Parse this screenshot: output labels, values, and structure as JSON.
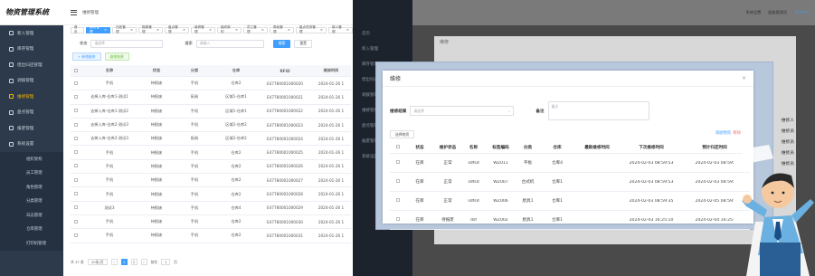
{
  "app": {
    "logo": "物资管理系统",
    "breadcrumb": "维修管理",
    "tabs": [
      "首页",
      "维修管理",
      "归还管理",
      "报废管理",
      "盘点管理",
      "维修管理",
      "组织架构",
      "员工管理",
      "角色管理",
      "盘点任务管理",
      "新入管理"
    ],
    "sidebar": [
      {
        "label": "新入管理",
        "active": false
      },
      {
        "label": "库存管理",
        "active": false
      },
      {
        "label": "借出归还管理",
        "active": false
      },
      {
        "label": "调拨管理",
        "active": false
      },
      {
        "label": "维修管理",
        "active": true
      },
      {
        "label": "盘点管理",
        "active": false
      },
      {
        "label": "报废管理",
        "active": false
      },
      {
        "label": "系统设置",
        "active": false
      }
    ],
    "sub_menu": [
      "组织架构",
      "员工管理",
      "角色管理",
      "分类管理",
      "日志管理",
      "仓库管理",
      "打印机管理"
    ],
    "filter": {
      "status_label": "状态",
      "status_placeholder": "请选择",
      "search_label": "搜索",
      "search_placeholder": "请输入",
      "search_btn": "搜索",
      "reset_btn": "重置"
    },
    "actions": {
      "add": "+ 新增维修",
      "repair": "维修结果"
    },
    "columns": [
      "名称",
      "状态",
      "分类",
      "仓库",
      "RFID",
      "维修时间"
    ],
    "rows": [
      [
        "手机",
        "待报废",
        "手机",
        "仓库2",
        "E47780001000020",
        "2024-01-26 1"
      ],
      [
        "去掉入库-仓库1-测试1",
        "待报废",
        "厨具",
        "区域1-仓库1",
        "E47780001000021",
        "2024-01-26 1"
      ],
      [
        "去掉入库-仓库1-测试2",
        "待报废",
        "手机",
        "区域1-仓库1",
        "E47780001000022",
        "2024-01-26 1"
      ],
      [
        "去掉入库-仓库2-测试3",
        "待报废",
        "手机",
        "区域2-仓库2",
        "E47780001000023",
        "2024-01-26 1"
      ],
      [
        "去掉入库-仓库2-测试3",
        "待报废",
        "厨具",
        "区域2-仓库2",
        "E47780001000024",
        "2024-01-26 1"
      ],
      [
        "手机",
        "待报废",
        "手机",
        "仓库2",
        "E47780001000025",
        "2024-01-26 1"
      ],
      [
        "手机",
        "待报废",
        "手机",
        "仓库2",
        "E47780001000026",
        "2024-01-26 1"
      ],
      [
        "手机",
        "待报废",
        "手机",
        "仓库2",
        "E47780001000027",
        "2024-01-26 1"
      ],
      [
        "手机",
        "待报废",
        "手机",
        "仓库2",
        "E47780001000028",
        "2024-01-26 1"
      ],
      [
        "测试3",
        "待报废",
        "手机",
        "仓库4",
        "E47780001000029",
        "2024-01-26 1"
      ],
      [
        "手机",
        "待报废",
        "手机",
        "仓库2",
        "E47780001000030",
        "2024-01-26 1"
      ],
      [
        "手机",
        "待报废",
        "手机",
        "仓库2",
        "E47780001000031",
        "2024-01-26 1"
      ]
    ],
    "pager": {
      "total": "共 37 条",
      "size": "20条/页",
      "pages": [
        "1",
        "2"
      ],
      "current": "1",
      "goto": "前往",
      "goto_val": "1",
      "unit": "页"
    }
  },
  "right": {
    "top_right": [
      "系统设置",
      "超级管理员",
      "个人中心"
    ],
    "bg_dialog_title": "维修",
    "dim_menu": [
      "首页",
      "新入管理",
      "库存管理",
      "借出归还管理",
      "调拨管理",
      "维修管理",
      "盘点管理",
      "报废管理",
      "系统设置"
    ],
    "bg_side_text": [
      "维修人",
      "维修员",
      "维修员",
      "维修员",
      "维修员"
    ]
  },
  "dialog": {
    "title": "维修",
    "result_label": "维修结果",
    "result_placeholder": "请选择",
    "remark_label": "备注",
    "remark_placeholder": "备注",
    "select_btn": "选择物资",
    "add_link": "添加物资",
    "del_link": "移除",
    "columns": [
      "状态",
      "维护状态",
      "名称",
      "标签编码",
      "分类",
      "仓库",
      "最新维修时间",
      "下次维修时间",
      "预计归还时间"
    ],
    "rows": [
      [
        "在库",
        "正常",
        "sdfsd",
        "WZ011",
        "平板",
        "仓库4",
        "",
        "2024-02-03 08:59:53",
        "2024-02-03 08:59:"
      ],
      [
        "在库",
        "正常",
        "sdfsd",
        "WZ007",
        "台式机",
        "仓库1",
        "",
        "2024-02-03 08:59:53",
        "2024-02-03 08:59:"
      ],
      [
        "在库",
        "正常",
        "sdfsd",
        "WZ006",
        "厨具1",
        "仓库1",
        "",
        "2024-02-03 08:59:35",
        "2024-02-05 08:59:"
      ],
      [
        "在库",
        "待报废",
        "dsf",
        "WZ002",
        "厨具1",
        "仓库1",
        "",
        "2024-02-03 16:25:10",
        "2024-02-04 16:25:"
      ]
    ]
  },
  "colors": {
    "primary": "#409eff",
    "sidebar": "#2d3a4b",
    "active_menu": "#f5b400"
  }
}
